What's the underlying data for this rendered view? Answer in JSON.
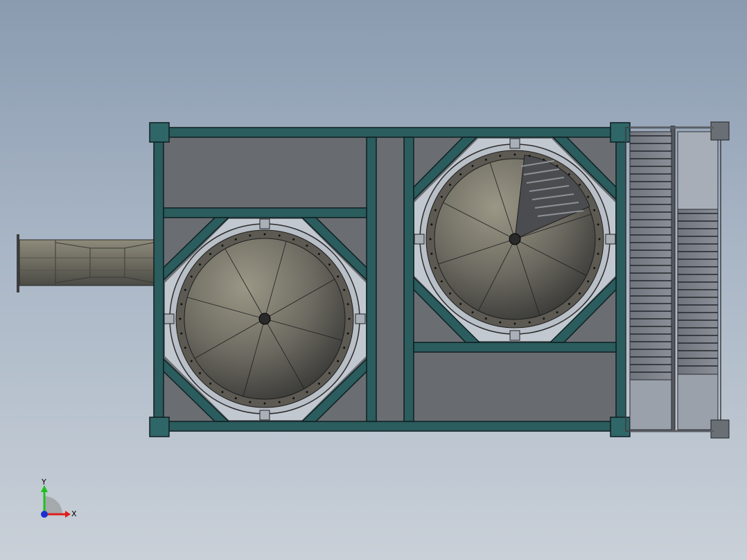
{
  "viewport": {
    "background_top": "#8a9bb0",
    "background_bottom": "#c9d0d8"
  },
  "model": {
    "frame_color": "#2b5c5e",
    "frame_outline": "#0f1f20",
    "panel_color": "#6a6e73",
    "cone_light": "#8a8778",
    "cone_dark": "#3c3c3a",
    "fan_blade_count": 8
  },
  "triad": {
    "y_label": "Y",
    "x_label": "X",
    "y_color": "#1ec21e",
    "x_color": "#e01b1b",
    "z_color": "#1a2fd0"
  }
}
